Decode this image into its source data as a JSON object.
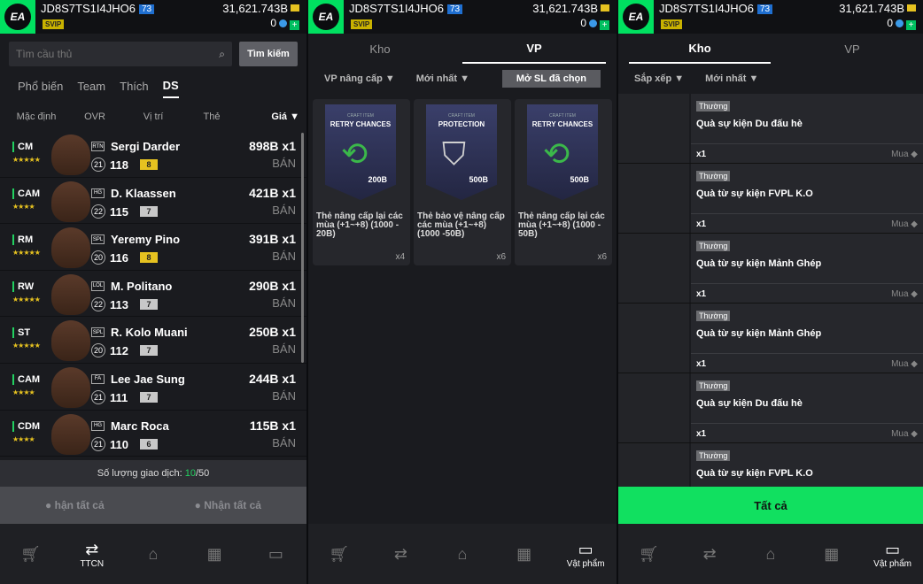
{
  "account": {
    "name": "JD8S7TS1I4JHO6",
    "level": "73",
    "vip": "SVIP",
    "coins": "31,621.743B",
    "cash": "0"
  },
  "market": {
    "search_placeholder": "Tìm cầu thủ",
    "search_button": "Tìm kiếm",
    "tabs": [
      "Phổ biến",
      "Team",
      "Thích",
      "DS"
    ],
    "columns": [
      "Mặc định",
      "OVR",
      "Vị trí",
      "Thẻ",
      "Giá"
    ],
    "players": [
      {
        "pos": "CM",
        "badge": "RTN",
        "name": "Sergi Darder",
        "season_num": "21",
        "ovr": "118",
        "upgrade": "8",
        "price": "898B x1",
        "sell": "BÁN",
        "upcolor": "#e6c220",
        "stars": "★★★★★"
      },
      {
        "pos": "CAM",
        "badge": "HG",
        "name": "D. Klaassen",
        "season_num": "22",
        "ovr": "115",
        "upgrade": "7",
        "price": "421B x1",
        "sell": "BÁN",
        "upcolor": "#c8c8c8",
        "stars": "★★★★"
      },
      {
        "pos": "RM",
        "badge": "SPL",
        "name": "Yeremy Pino",
        "season_num": "20",
        "ovr": "116",
        "upgrade": "8",
        "price": "391B x1",
        "sell": "BÁN",
        "upcolor": "#e6c220",
        "stars": "★★★★★"
      },
      {
        "pos": "RW",
        "badge": "LOL",
        "name": "M. Politano",
        "season_num": "22",
        "ovr": "113",
        "upgrade": "7",
        "price": "290B x1",
        "sell": "BÁN",
        "upcolor": "#c8c8c8",
        "stars": "★★★★★"
      },
      {
        "pos": "ST",
        "badge": "SPL",
        "name": "R. Kolo Muani",
        "season_num": "20",
        "ovr": "112",
        "upgrade": "7",
        "price": "250B x1",
        "sell": "BÁN",
        "upcolor": "#c8c8c8",
        "stars": "★★★★★"
      },
      {
        "pos": "CAM",
        "badge": "FA",
        "name": "Lee Jae Sung",
        "season_num": "21",
        "ovr": "111",
        "upgrade": "7",
        "price": "244B x1",
        "sell": "BÁN",
        "upcolor": "#c8c8c8",
        "stars": "★★★★"
      },
      {
        "pos": "CDM",
        "badge": "HG",
        "name": "Marc Roca",
        "season_num": "21",
        "ovr": "110",
        "upgrade": "6",
        "price": "115B x1",
        "sell": "BÁN",
        "upcolor": "#c8c8c8",
        "stars": "★★★★"
      }
    ],
    "trade_label": "Số lượng giao dịch:",
    "trade_used": "10",
    "trade_max": "/50",
    "claim_left": "hận tất cả",
    "claim_right": "Nhận tất cả"
  },
  "nav": {
    "trade_label": "TTCN",
    "items_label": "Vật phẩm"
  },
  "vp": {
    "tabs": [
      "Kho",
      "VP"
    ],
    "filter1": "VP nâng cấp ▼",
    "filter2": "Mới nhất ▼",
    "open_button": "Mở SL đã chọn",
    "cards": [
      {
        "craft": "CRAFT ITEM",
        "title": "RETRY CHANCES",
        "price": "200B",
        "desc": "Thẻ nâng cấp lại các mùa (+1~+8) (1000 - 20B)",
        "qty": "x4"
      },
      {
        "craft": "CRAFT ITEM",
        "title": "PROTECTION",
        "price": "500B",
        "desc": "Thẻ bảo vệ nâng cấp các mùa (+1~+8) (1000 -50B)",
        "qty": "x6"
      },
      {
        "craft": "CRAFT ITEM",
        "title": "RETRY CHANCES",
        "price": "500B",
        "desc": "Thẻ nâng cấp lại các mùa (+1~+8) (1000 - 50B)",
        "qty": "x6"
      }
    ]
  },
  "kho": {
    "tabs": [
      "Kho",
      "VP"
    ],
    "filter1": "Sắp xếp ▼",
    "filter2": "Mới nhất ▼",
    "items": [
      {
        "tag": "Thường",
        "name": "Quà sự kiện Du đấu hè",
        "qty": "x1",
        "buy": "Mua"
      },
      {
        "tag": "Thường",
        "name": "Quà từ sự kiện FVPL K.O",
        "qty": "x1",
        "buy": "Mua"
      },
      {
        "tag": "Thường",
        "name": "Quà từ sự kiện Mảnh Ghép",
        "qty": "x1",
        "buy": "Mua"
      },
      {
        "tag": "Thường",
        "name": "Quà từ sự kiện Mảnh Ghép",
        "qty": "x1",
        "buy": "Mua"
      },
      {
        "tag": "Thường",
        "name": "Quà sự kiện Du đấu hè",
        "qty": "x1",
        "buy": "Mua"
      },
      {
        "tag": "Thường",
        "name": "Quà từ sự kiện FVPL K.O",
        "qty": "",
        "buy": ""
      }
    ],
    "all_button": "Tất cả"
  },
  "colors": {
    "accent": "#11e060",
    "gold": "#e6c220"
  }
}
